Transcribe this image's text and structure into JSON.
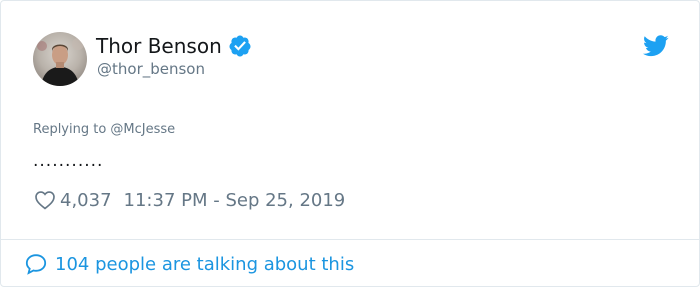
{
  "tweet": {
    "author": {
      "display_name": "Thor Benson",
      "handle": "@thor_benson",
      "verified": true,
      "avatar_icon": "user-avatar-photo"
    },
    "brand_icon": "twitter-bird-icon",
    "replying_to": "Replying to @McJesse",
    "text": "...........",
    "likes": "4,037",
    "timestamp": "11:37 PM - Sep 25, 2019"
  },
  "footer": {
    "talking_text": "104 people are talking about this",
    "icon": "comment-bubble-icon"
  },
  "colors": {
    "brand_blue": "#1da1f2",
    "link_blue": "#1b95e0",
    "text_primary": "#14171a",
    "text_secondary": "#657786",
    "border": "#e1e8ed"
  }
}
